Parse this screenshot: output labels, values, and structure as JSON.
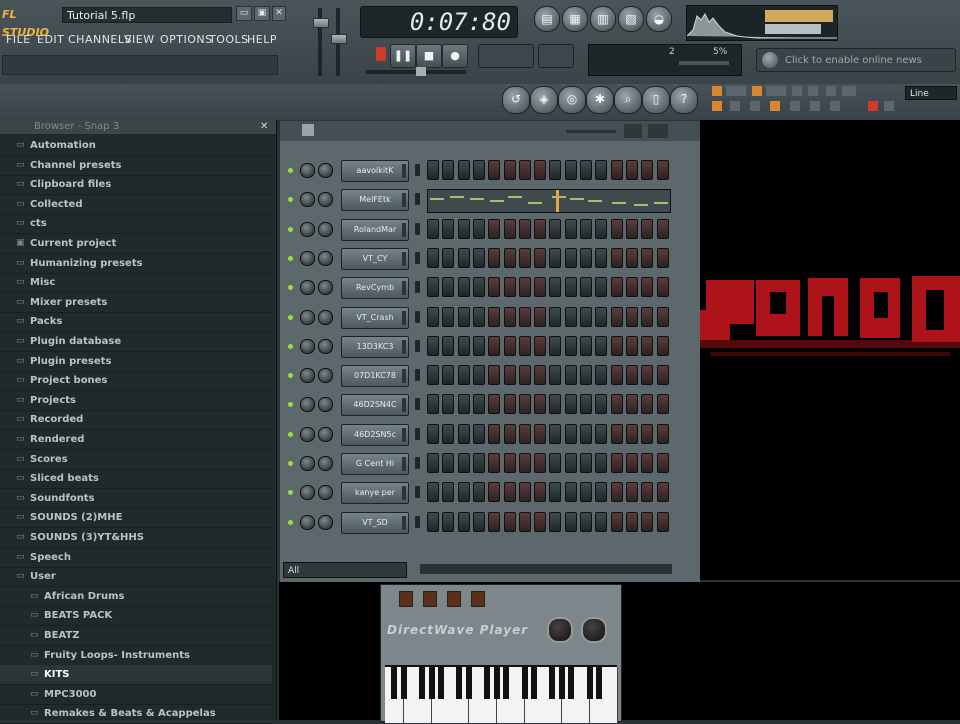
{
  "app": {
    "logo": "FL STUDIO",
    "song_title": "Tutorial 5.flp",
    "window_buttons": [
      "▭",
      "▣",
      "✕"
    ]
  },
  "menu": [
    "FILE",
    "EDIT",
    "CHANNELS",
    "VIEW",
    "OPTIONS",
    "TOOLS",
    "HELP"
  ],
  "transport": {
    "time": "0:07:80"
  },
  "news": {
    "text": "Click to enable online news"
  },
  "cpu_panel": {
    "readout_left": "2",
    "readout_right": "5%"
  },
  "pattern_mode": {
    "label": "Line"
  },
  "browser": {
    "title": "Browser - Snap 3",
    "items": [
      {
        "label": "Automation",
        "type": "folder",
        "sub": false
      },
      {
        "label": "Channel presets",
        "type": "folder",
        "sub": false
      },
      {
        "label": "Clipboard files",
        "type": "folder",
        "sub": false
      },
      {
        "label": "Collected",
        "type": "folder",
        "sub": false
      },
      {
        "label": "cts",
        "type": "folder",
        "sub": false
      },
      {
        "label": "Current project",
        "type": "project",
        "sub": false
      },
      {
        "label": "Humanizing presets",
        "type": "folder",
        "sub": false
      },
      {
        "label": "Misc",
        "type": "folder",
        "sub": false
      },
      {
        "label": "Mixer presets",
        "type": "folder",
        "sub": false
      },
      {
        "label": "Packs",
        "type": "folder",
        "sub": false
      },
      {
        "label": "Plugin database",
        "type": "folder",
        "sub": false
      },
      {
        "label": "Plugin presets",
        "type": "folder",
        "sub": false
      },
      {
        "label": "Project bones",
        "type": "folder",
        "sub": false
      },
      {
        "label": "Projects",
        "type": "folder",
        "sub": false
      },
      {
        "label": "Recorded",
        "type": "folder",
        "sub": false
      },
      {
        "label": "Rendered",
        "type": "folder",
        "sub": false
      },
      {
        "label": "Scores",
        "type": "folder",
        "sub": false
      },
      {
        "label": "Sliced beats",
        "type": "folder",
        "sub": false
      },
      {
        "label": "Soundfonts",
        "type": "folder",
        "sub": false
      },
      {
        "label": "SOUNDS (2)MHE",
        "type": "folder",
        "sub": false
      },
      {
        "label": "SOUNDS (3)YT&HHS",
        "type": "folder",
        "sub": false
      },
      {
        "label": "Speech",
        "type": "folder",
        "sub": false
      },
      {
        "label": "User",
        "type": "folder",
        "sub": false
      },
      {
        "label": "African Drums",
        "type": "folder",
        "sub": true
      },
      {
        "label": "BEATS PACK",
        "type": "folder",
        "sub": true
      },
      {
        "label": "BEATZ",
        "type": "folder",
        "sub": true
      },
      {
        "label": "Fruity Loops- Instruments",
        "type": "folder",
        "sub": true
      },
      {
        "label": "KITS",
        "type": "folder",
        "sub": true,
        "selected": true
      },
      {
        "label": "MPC3000",
        "type": "folder",
        "sub": true
      },
      {
        "label": "Remakes & Beats & Acappelas",
        "type": "folder",
        "sub": true
      }
    ]
  },
  "step_sequencer": {
    "filter": "All",
    "channels": [
      {
        "name": "aavolkitK",
        "pianoroll": false,
        "lit": []
      },
      {
        "name": "MelFEtk",
        "pianoroll": true,
        "lit": []
      },
      {
        "name": "RolandMar",
        "pianoroll": false,
        "lit": []
      },
      {
        "name": "VT_CY",
        "pianoroll": false,
        "lit": []
      },
      {
        "name": "RevCymb",
        "pianoroll": false,
        "lit": []
      },
      {
        "name": "VT_Crash",
        "pianoroll": false,
        "lit": []
      },
      {
        "name": "13D3KC3",
        "pianoroll": false,
        "lit": []
      },
      {
        "name": "07D1KC78",
        "pianoroll": false,
        "lit": []
      },
      {
        "name": "46D2SN4C",
        "pianoroll": false,
        "lit": []
      },
      {
        "name": "46D2SN5c",
        "pianoroll": false,
        "lit": []
      },
      {
        "name": "G Cent Hi",
        "pianoroll": false,
        "lit": []
      },
      {
        "name": "kanye per",
        "pianoroll": false,
        "lit": []
      },
      {
        "name": "VT_SD",
        "pianoroll": false,
        "lit": []
      }
    ],
    "red_step_groups": [
      4,
      5,
      6,
      7,
      12,
      13,
      14,
      15
    ]
  },
  "plugin": {
    "title": "DirectWave Player"
  },
  "colors": {
    "accent_led": "#9adf3c",
    "logo": "#f0b43a",
    "visual_red": "#c0161b"
  }
}
